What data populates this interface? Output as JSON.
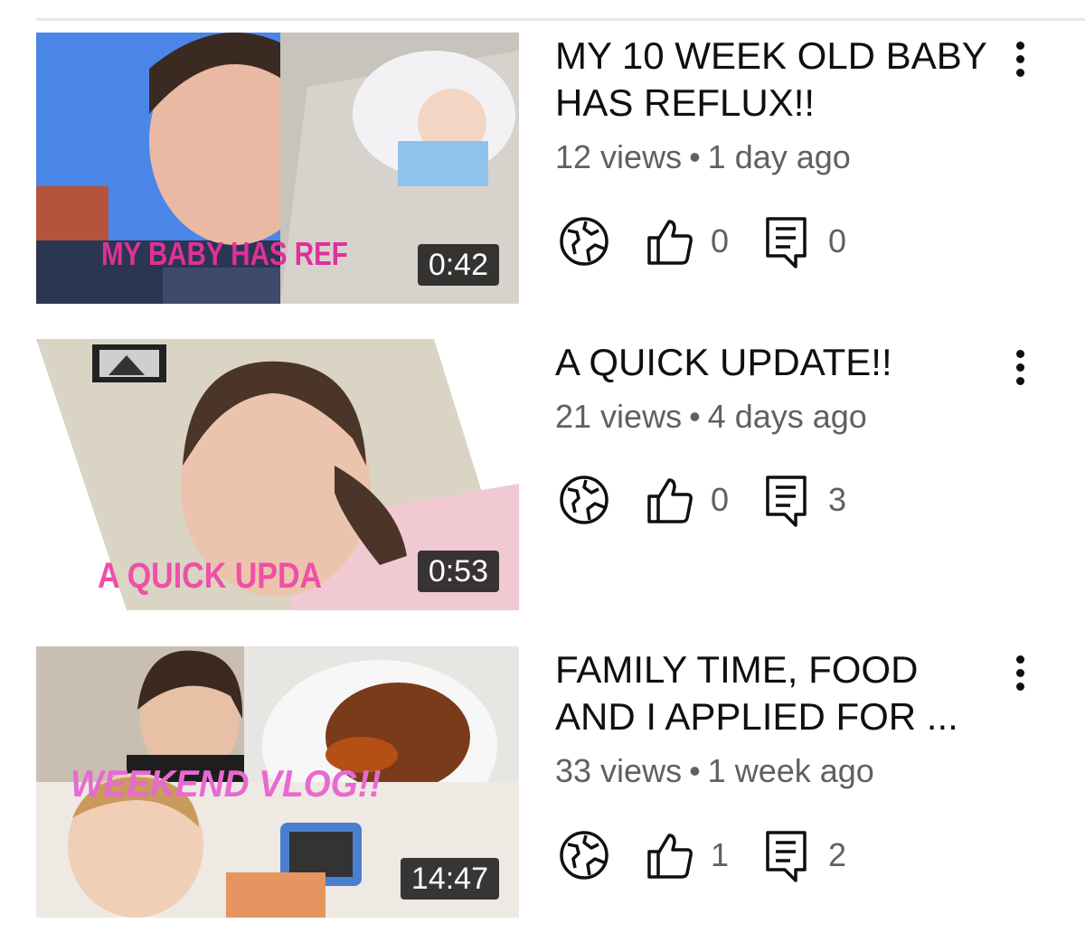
{
  "videos": [
    {
      "title": "MY 10 WEEK OLD BABY HAS REFLUX!!",
      "views": "12 views",
      "age": "1 day ago",
      "duration": "0:42",
      "likes": "0",
      "comments": "0",
      "thumbnail_text": "MY BABY HAS REF"
    },
    {
      "title": "A QUICK UPDATE!!",
      "views": "21 views",
      "age": "4 days ago",
      "duration": "0:53",
      "likes": "0",
      "comments": "3",
      "thumbnail_text": "A QUICK UPDA"
    },
    {
      "title": "FAMILY TIME, FOOD AND I APPLIED FOR ...",
      "views": "33 views",
      "age": "1 week ago",
      "duration": "14:47",
      "likes": "1",
      "comments": "2",
      "thumbnail_text": "WEEKEND VLOG!!"
    }
  ],
  "separator": "•",
  "colors": {
    "text": "#0f0f0f",
    "secondary": "#606060",
    "thumb_text_pink": "#e0309a"
  },
  "icons": {
    "visibility": "globe-icon",
    "likes": "thumbs-up-icon",
    "comments": "comment-icon",
    "more": "more-vert-icon"
  }
}
